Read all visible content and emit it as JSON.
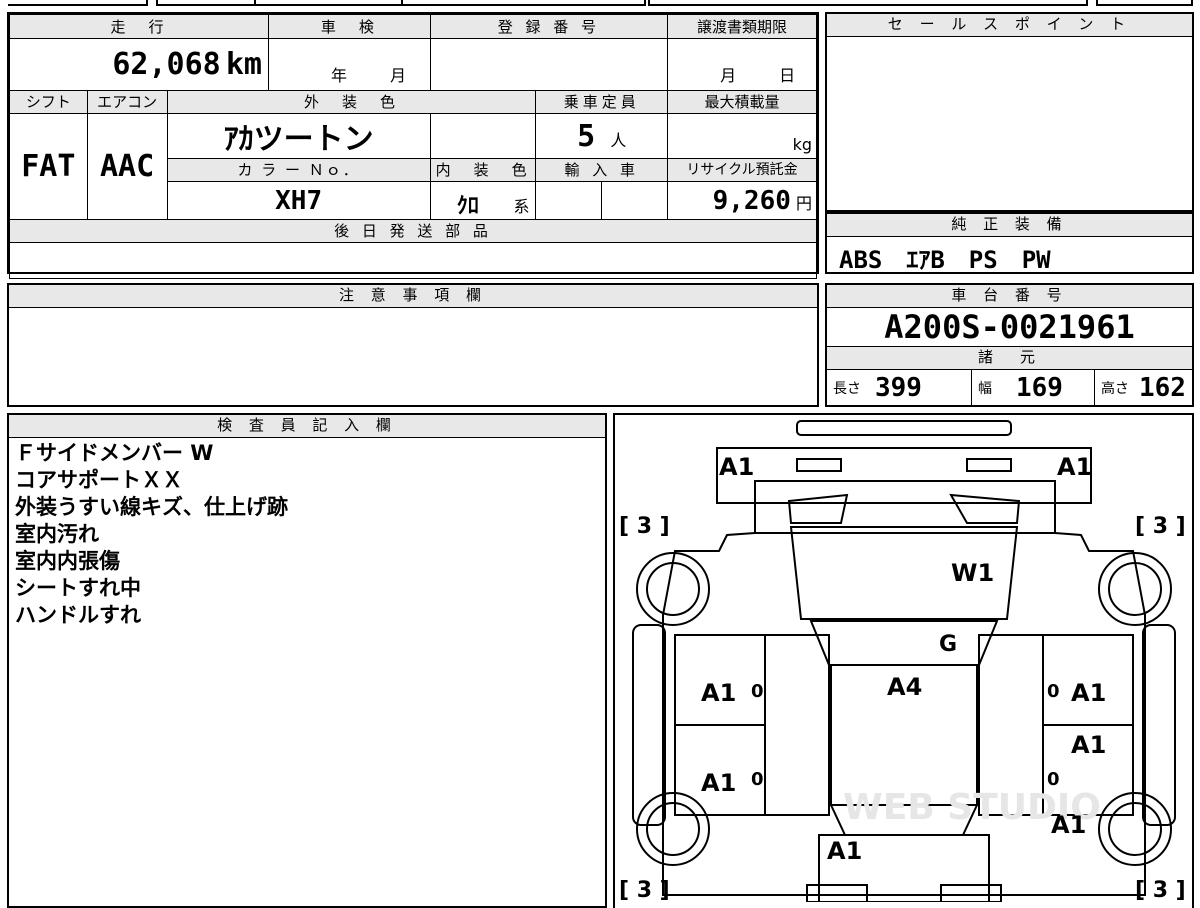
{
  "sheet": {
    "mileage_label": "走　行",
    "mileage_value": "62,068",
    "mileage_unit": "km",
    "inspection_label": "車　検",
    "inspection_year": "年",
    "inspection_month": "月",
    "registration_label": "登 録 番 号",
    "transfer_label": "譲渡書類期限",
    "transfer_month": "月",
    "transfer_day": "日",
    "shift_label": "シフト",
    "shift_value": "FAT",
    "ac_label": "エアコン",
    "ac_value": "AAC",
    "exterior_label": "外　装　色",
    "exterior_value": "ｱｶツートン",
    "capacity_label": "乗車定員",
    "capacity_value": "5",
    "capacity_unit": "人",
    "maxload_label": "最大積載量",
    "maxload_unit": "kg",
    "colorno_label": "カ ラ ー Ｎｏ．",
    "colorno_value": "XH7",
    "interior_label": "内　装　色",
    "interior_value": "ｸﾛ",
    "interior_unit": "系",
    "import_label": "輸 入 車",
    "recycle_label": "リサイクル預託金",
    "recycle_value": "9,260",
    "recycle_unit": "円",
    "later_parts_label": "後 日 発 送 部 品",
    "notes_label": "注 意 事 項 欄",
    "inspector_label": "検 査 員 記 入 欄"
  },
  "sales": {
    "label": "セ ー ル ス ポ イ ン ト"
  },
  "equipment": {
    "label": "純 正 装 備",
    "value": "ABS　ｴｱB　PS　PW"
  },
  "chassis": {
    "label": "車 台 番 号",
    "value": "A200S-0021961"
  },
  "specs": {
    "label": "諸　元",
    "length_label": "長さ",
    "length_value": "399",
    "width_label": "幅",
    "width_value": "169",
    "height_label": "高さ",
    "height_value": "162"
  },
  "remarks": [
    "Ｆサイドメンバー W",
    "コアサポートＸＸ",
    "外装うすい線キズ、仕上げ跡",
    "室内汚れ",
    "室内内張傷",
    "シートすれ中",
    "ハンドルすれ"
  ],
  "diagram": {
    "tire_tl": "[ 3 ]",
    "tire_tr": "[ 3 ]",
    "tire_bl": "[ 3 ]",
    "tire_br": "[ 3 ]",
    "m_a1_tl": "A1",
    "m_a1_tr": "A1",
    "m_w1": "W1",
    "m_g": "G",
    "m_a4": "A4",
    "m_a1_l1": "A1",
    "m_a1_l2": "A1",
    "m_a1_r1": "A1",
    "m_a1_r2": "A1",
    "m_a1_r3": "A1",
    "m_a1_rear": "A1",
    "zero_1": "0",
    "zero_2": "0",
    "zero_3": "0",
    "zero_4": "0",
    "watermark": "WEB STUDIO"
  }
}
